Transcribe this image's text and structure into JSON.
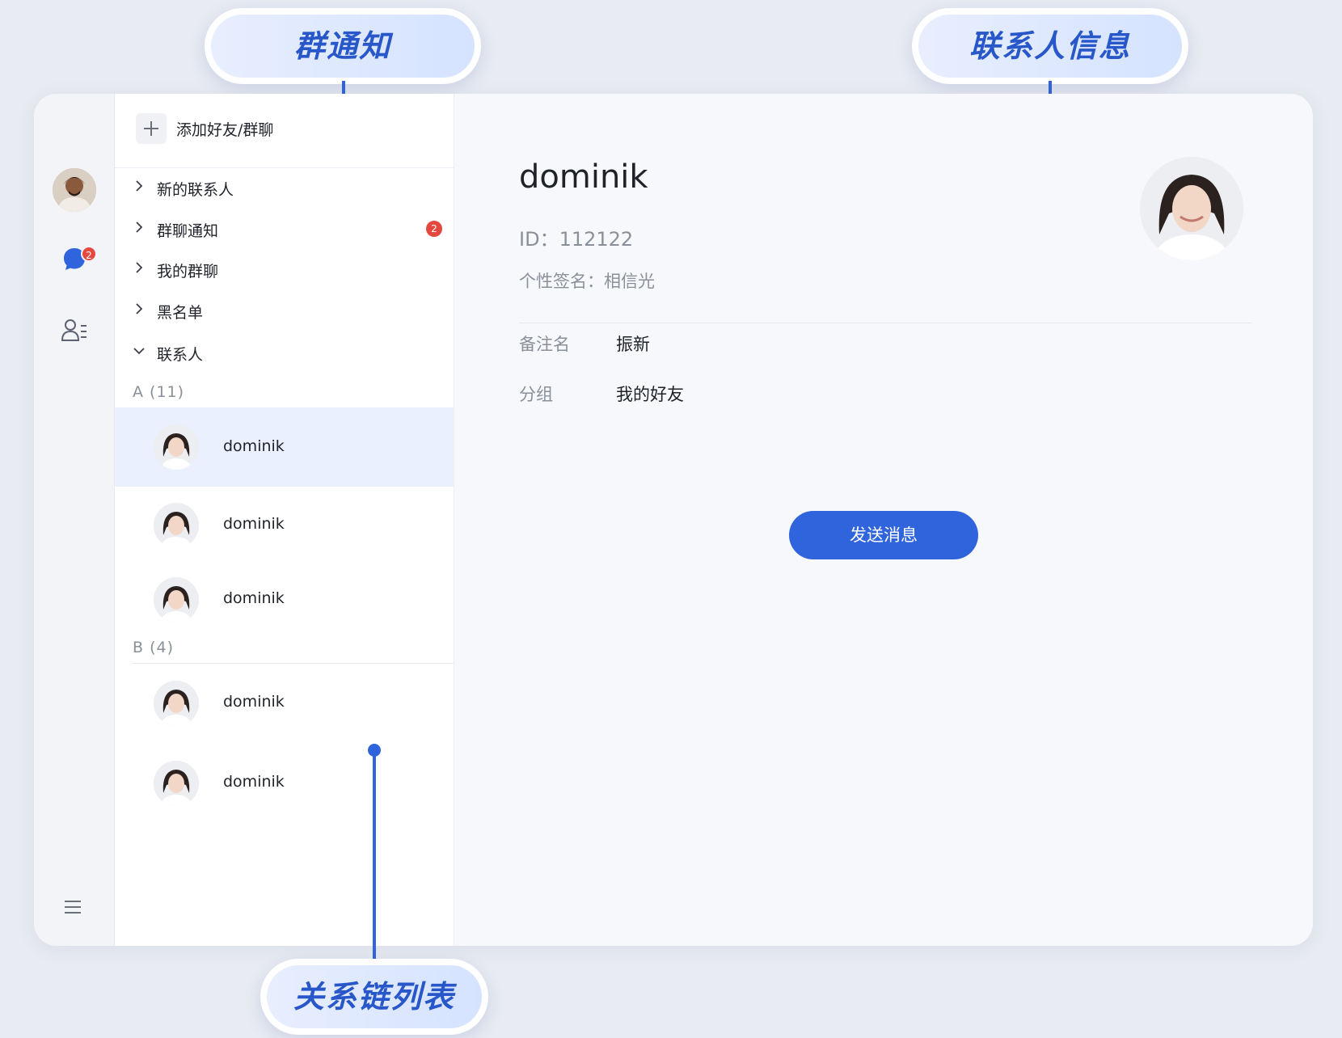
{
  "annotations": {
    "group_notice": "群通知",
    "contact_info": "联系人信息",
    "relation_list": "关系链列表"
  },
  "nav": {
    "unread_badge": "2",
    "icons": [
      "user-avatar",
      "chat-bubble-icon",
      "contacts-icon",
      "menu-icon"
    ]
  },
  "list": {
    "add_label": "添加好友/群聊",
    "sections": [
      {
        "label": "新的联系人",
        "badge": ""
      },
      {
        "label": "群聊通知",
        "badge": "2"
      },
      {
        "label": "我的群聊",
        "badge": ""
      },
      {
        "label": "黑名单",
        "badge": ""
      },
      {
        "label": "联系人",
        "badge": ""
      }
    ],
    "groups": [
      {
        "letter": "A",
        "count": "(11)",
        "contacts": [
          "dominik",
          "dominik",
          "dominik"
        ]
      },
      {
        "letter": "B",
        "count": "(4)",
        "contacts": [
          "dominik",
          "dominik"
        ]
      }
    ]
  },
  "detail": {
    "name": "dominik",
    "id_label": "ID：",
    "id_value": "112122",
    "signature_label": "个性签名：",
    "signature_value": "相信光",
    "remark_label": "备注名",
    "remark_value": "振新",
    "group_label": "分组",
    "group_value": "我的好友",
    "send_button": "发送消息"
  },
  "colors": {
    "accent": "#2f64dc",
    "badge": "#e5483f",
    "selected_row": "#eaf0fd"
  }
}
